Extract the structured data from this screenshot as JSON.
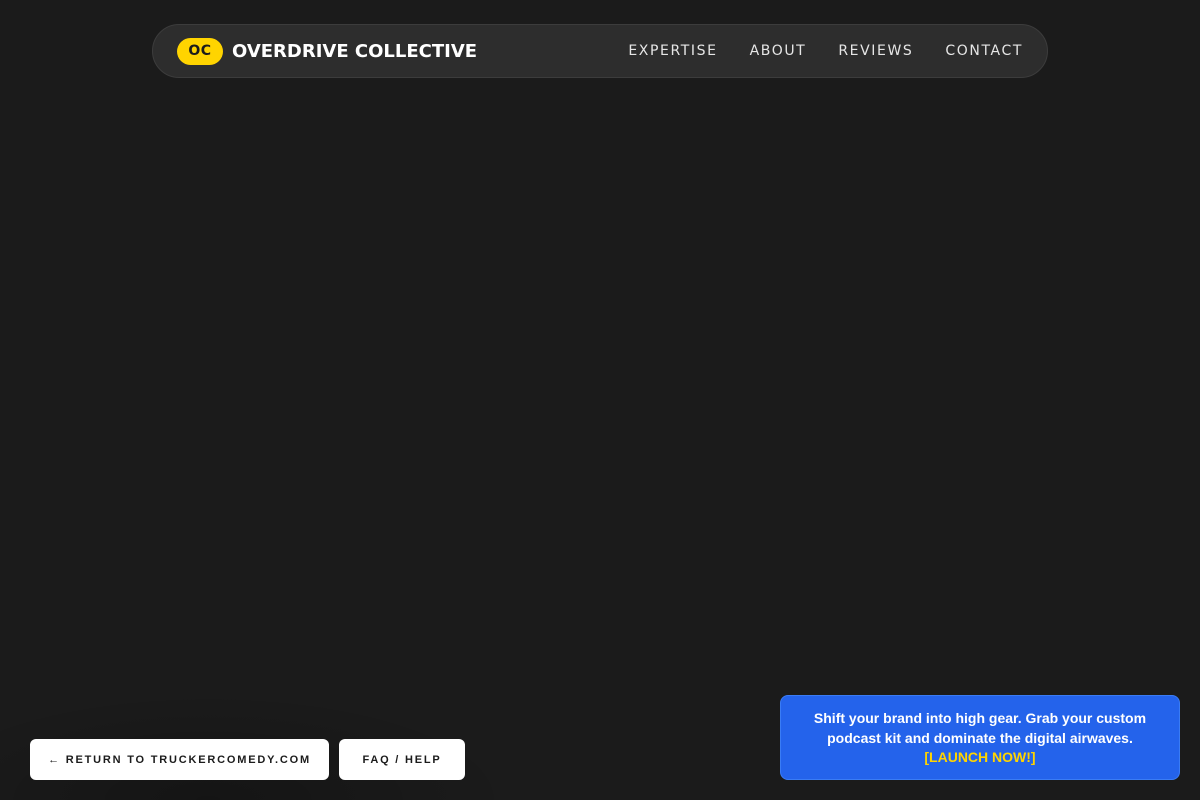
{
  "colors": {
    "background": "#1b1b1b",
    "navbar": "#2d2d2d",
    "accent_yellow": "#ffd400",
    "promo_blue": "#2463eb",
    "button_white": "#ffffff"
  },
  "header": {
    "brand_badge": "OC",
    "brand_name": "OVERDRIVE COLLECTIVE",
    "nav": [
      {
        "label": "EXPERTISE"
      },
      {
        "label": "ABOUT"
      },
      {
        "label": "REVIEWS"
      },
      {
        "label": "CONTACT"
      }
    ]
  },
  "footer": {
    "return_label": "← RETURN TO TRUCKERCOMEDY.COM",
    "faq_label": "FAQ / HELP"
  },
  "promo": {
    "text": "Shift your brand into high gear. Grab your custom podcast kit and dominate the digital airwaves.",
    "cta": "[LAUNCH NOW!]"
  }
}
